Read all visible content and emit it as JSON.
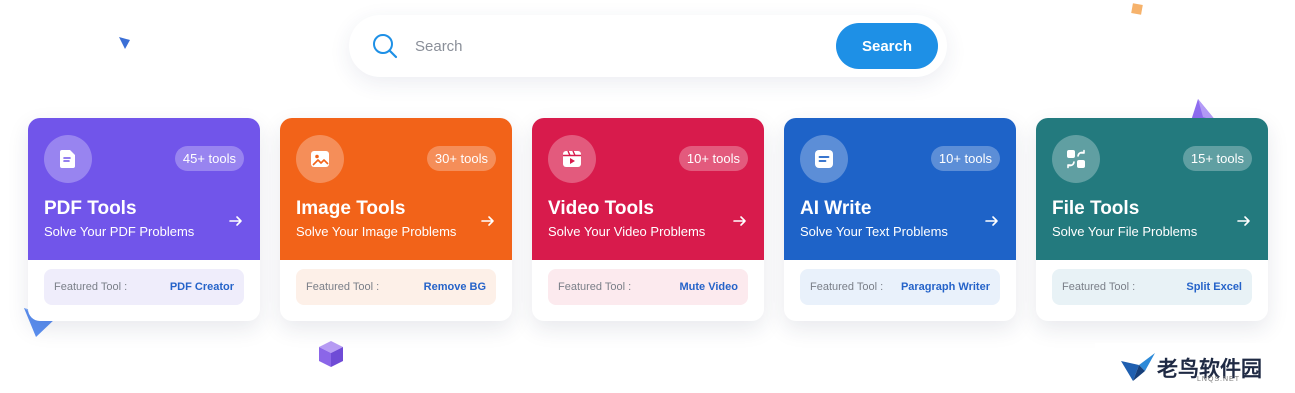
{
  "search": {
    "placeholder": "Search",
    "button_label": "Search",
    "icon": "search-icon"
  },
  "featured_label": "Featured Tool :",
  "cards": [
    {
      "title": "PDF Tools",
      "subtitle": "Solve Your PDF Problems",
      "count": "45+ tools",
      "icon": "pdf-file-icon",
      "featured_tool": "PDF Creator",
      "color": "#7155ea",
      "featured_bg": "#efedfb"
    },
    {
      "title": "Image Tools",
      "subtitle": "Solve Your Image Problems",
      "count": "30+ tools",
      "icon": "image-icon",
      "featured_tool": "Remove BG",
      "color": "#f26319",
      "featured_bg": "#fdf0e8"
    },
    {
      "title": "Video Tools",
      "subtitle": "Solve Your Video Problems",
      "count": "10+ tools",
      "icon": "video-play-icon",
      "featured_tool": "Mute Video",
      "color": "#d81b4c",
      "featured_bg": "#fceaee"
    },
    {
      "title": "AI Write",
      "subtitle": "Solve Your Text Problems",
      "count": "10+ tools",
      "icon": "document-text-icon",
      "featured_tool": "Paragraph Writer",
      "color": "#1e63c8",
      "featured_bg": "#e9f1fb"
    },
    {
      "title": "File Tools",
      "subtitle": "Solve Your File Problems",
      "count": "15+ tools",
      "icon": "file-convert-icon",
      "featured_tool": "Split Excel",
      "color": "#237a7e",
      "featured_bg": "#e8f2f6"
    }
  ],
  "watermark": {
    "text": "老鸟软件园",
    "sub": "LNQS.NET"
  }
}
